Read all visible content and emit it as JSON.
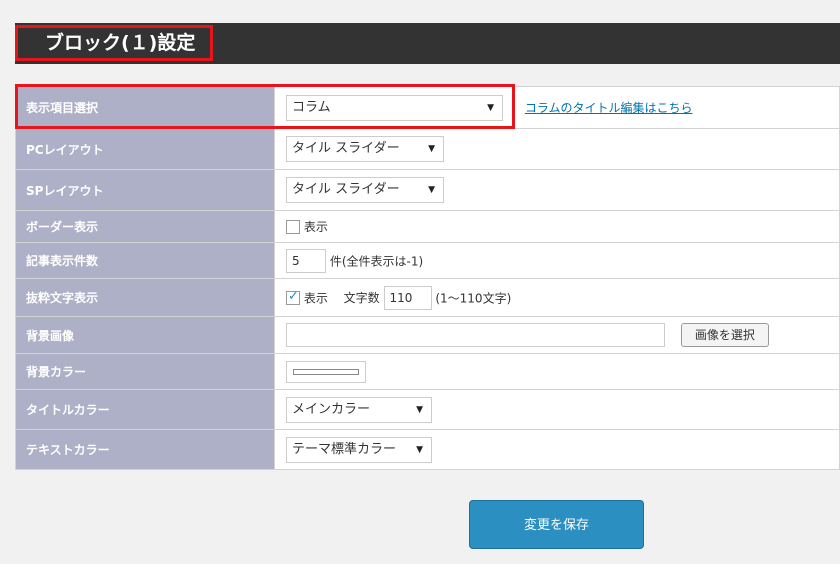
{
  "header": {
    "title": "ブロック(１)設定"
  },
  "rows": {
    "display_item": {
      "label": "表示項目選択",
      "select": "コラム",
      "link": "コラムのタイトル編集はこちら"
    },
    "pc_layout": {
      "label": "PCレイアウト",
      "select": "タイル スライダー"
    },
    "sp_layout": {
      "label": "SPレイアウト",
      "select": "タイル スライダー"
    },
    "border": {
      "label": "ボーダー表示",
      "checkbox_label": "表示",
      "checked": false
    },
    "count": {
      "label": "記事表示件数",
      "value": "5",
      "hint": "件(全件表示は-1)"
    },
    "excerpt": {
      "label": "抜粋文字表示",
      "checkbox_label": "表示",
      "checked": true,
      "chars_label": "文字数",
      "chars_value": "110",
      "hint": "(1〜110文字)"
    },
    "bg_image": {
      "label": "背景画像",
      "value": "",
      "button": "画像を選択"
    },
    "bg_color": {
      "label": "背景カラー",
      "color": "#ffffff"
    },
    "title_color": {
      "label": "タイトルカラー",
      "select": "メインカラー"
    },
    "text_color": {
      "label": "テキストカラー",
      "select": "テーマ標準カラー"
    }
  },
  "save_button": "変更を保存",
  "colors": {
    "header_bg": "#333333",
    "label_bg": "#aeb0c7",
    "accent": "#2b8fc2",
    "highlight": "#e8141b"
  }
}
